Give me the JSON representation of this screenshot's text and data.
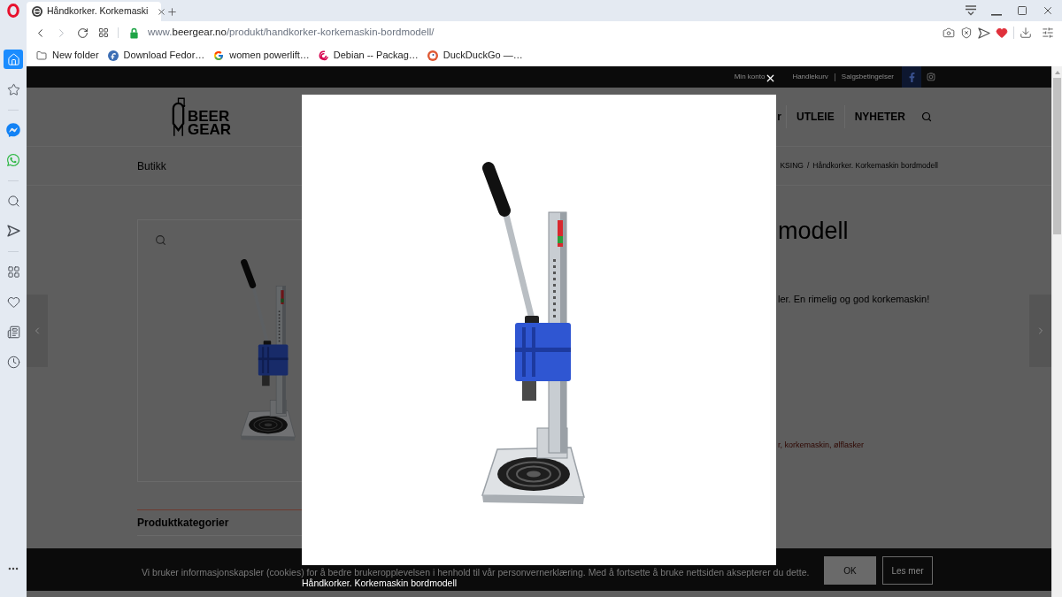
{
  "browser": {
    "tabs": [
      {
        "title": "Håndkorker. Korkemaski",
        "selected": true
      }
    ],
    "address": {
      "prefix": "www.",
      "domain": "beergear.no",
      "path": "/produkt/handkorker-korkemaskin-bordmodell/"
    },
    "bookmarks": [
      {
        "kind": "folder",
        "label": "New folder"
      },
      {
        "kind": "fedora",
        "label": "Download Fedor…"
      },
      {
        "kind": "google",
        "label": "women powerlift…"
      },
      {
        "kind": "debian",
        "label": "Debian -- Packag…"
      },
      {
        "kind": "duckduckgo",
        "label": "DuckDuckGo —…"
      }
    ],
    "sidebar": {
      "groups": [
        [
          {
            "kind": "home",
            "selected": true
          },
          {
            "kind": "star",
            "selected": false
          }
        ],
        [
          {
            "kind": "messenger",
            "selected": false
          },
          {
            "kind": "whatsapp",
            "selected": false
          }
        ],
        [
          {
            "kind": "search",
            "selected": false
          },
          {
            "kind": "send",
            "selected": false
          }
        ],
        [
          {
            "kind": "grid",
            "selected": false
          },
          {
            "kind": "heart",
            "selected": false
          },
          {
            "kind": "news",
            "selected": false
          },
          {
            "kind": "history",
            "selected": false
          }
        ]
      ]
    }
  },
  "site": {
    "top_links": [
      "Min konto",
      "Handlekurv",
      "Salgsbetingelser"
    ],
    "logo": [
      "BEER",
      "GEAR"
    ],
    "nav": [
      "r",
      "UTLEIE",
      "NYHETER"
    ],
    "breadcrumb": {
      "current_section": "Butikk",
      "trail": [
        "KSING",
        "Håndkorker. Korkemaskin bordmodell"
      ],
      "separator": "/"
    },
    "product": {
      "title": "modell",
      "description": "ler. En rimelig og god korkemaskin!",
      "tags": "r, korkemaskin, ølflasker"
    },
    "sidebar_heading": "Produktkategorier",
    "cookie_bar": {
      "text": "Vi bruker informasjonskapsler (cookies) for å bedre brukeropplevelsen i henhold til vår personvernerklæring. Med å fortsette å bruke nettsiden aksepterer du dette.",
      "buttons": [
        "OK",
        "Les mer"
      ]
    }
  },
  "lightbox": {
    "caption": "Håndkorker. Korkemaskin bordmodell"
  }
}
